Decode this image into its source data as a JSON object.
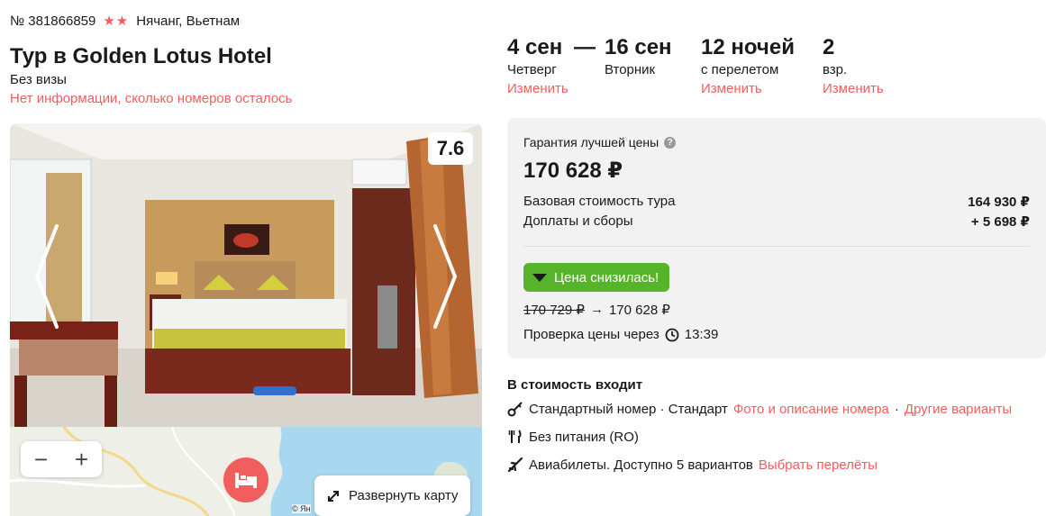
{
  "tour": {
    "number": "№ 381866859",
    "stars": "★★",
    "location": "Нячанг, Вьетнам",
    "title": "Тур в Golden Lotus Hotel",
    "visa": "Без визы",
    "rooms_note": "Нет информации, сколько номеров осталось",
    "rating": "7.6"
  },
  "dates": {
    "start": {
      "date": "4 сен",
      "weekday": "Четверг",
      "change": "Изменить"
    },
    "dash": "—",
    "end": {
      "date": "16 сен",
      "weekday": "Вторник"
    },
    "nights": {
      "value": "12 ночей",
      "note": "с перелетом",
      "change": "Изменить"
    },
    "guests": {
      "value": "2",
      "note": "взр.",
      "change": "Изменить"
    }
  },
  "price": {
    "guarantee": "Гарантия лучшей цены",
    "help_icon": "?",
    "total": "170 628 ₽",
    "base_label": "Базовая стоимость тура",
    "base_value": "164 930 ₽",
    "fees_label": "Доплаты и сборы",
    "fees_value": "+ 5 698 ₽",
    "drop_label": "Цена снизилась!",
    "old_price": "170 729 ₽",
    "arrow": "→",
    "new_price": "170 628 ₽",
    "check_label": "Проверка цены через",
    "check_time": "13:39"
  },
  "map": {
    "zoom_out": "−",
    "zoom_in": "+",
    "expand_label": "Развернуть карту",
    "copyright": "© Ян"
  },
  "includes": {
    "title": "В стоимость входит",
    "room": {
      "text": "Стандартный номер · Стандарт",
      "photo_link": "Фото и описание номера",
      "sep": "·",
      "other_link": "Другие варианты"
    },
    "meals": {
      "text": "Без питания (RO)"
    },
    "flights": {
      "text": "Авиабилеты. Доступно 5 вариантов",
      "link": "Выбрать перелёты"
    }
  },
  "colors": {
    "accent": "#f25d5d",
    "success": "#56b42b",
    "panel": "#f2f2f2"
  },
  "icons": {
    "key": "key-icon",
    "meals": "fork-knife-icon",
    "flights": "airplane-icon",
    "clock": "clock-icon",
    "hotel": "bed-icon",
    "expand": "expand-arrows-icon"
  }
}
